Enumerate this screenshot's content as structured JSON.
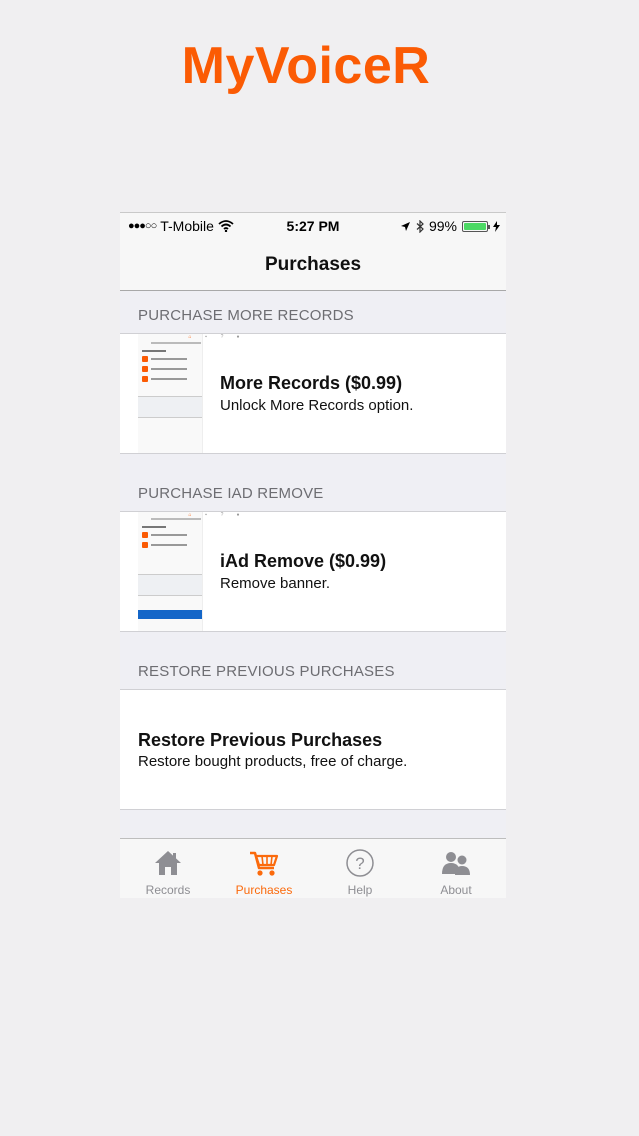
{
  "app_title": "MyVoiceR",
  "status_bar": {
    "signal": "●●●○○",
    "carrier": "T-Mobile",
    "time": "5:27 PM",
    "battery_percent": "99%",
    "battery_level": 0.99
  },
  "nav": {
    "title": "Purchases"
  },
  "sections": [
    {
      "header": "PURCHASE MORE RECORDS",
      "title": "More Records ($0.99)",
      "subtitle": "Unlock More Records option."
    },
    {
      "header": "PURCHASE IAD REMOVE",
      "title": "iAd Remove ($0.99)",
      "subtitle": "Remove banner."
    },
    {
      "header": "RESTORE PREVIOUS PURCHASES",
      "title": "Restore Previous Purchases",
      "subtitle": "Restore bought products, free of charge."
    }
  ],
  "tabbar": {
    "items": [
      {
        "label": "Records",
        "icon": "home-icon"
      },
      {
        "label": "Purchases",
        "icon": "cart-icon",
        "active": true
      },
      {
        "label": "Help",
        "icon": "help-icon"
      },
      {
        "label": "About",
        "icon": "people-icon"
      }
    ]
  },
  "colors": {
    "accent": "#fb5b04",
    "tab_inactive": "#8e8e93",
    "background": "#efeff4",
    "battery": "#4cd964"
  }
}
